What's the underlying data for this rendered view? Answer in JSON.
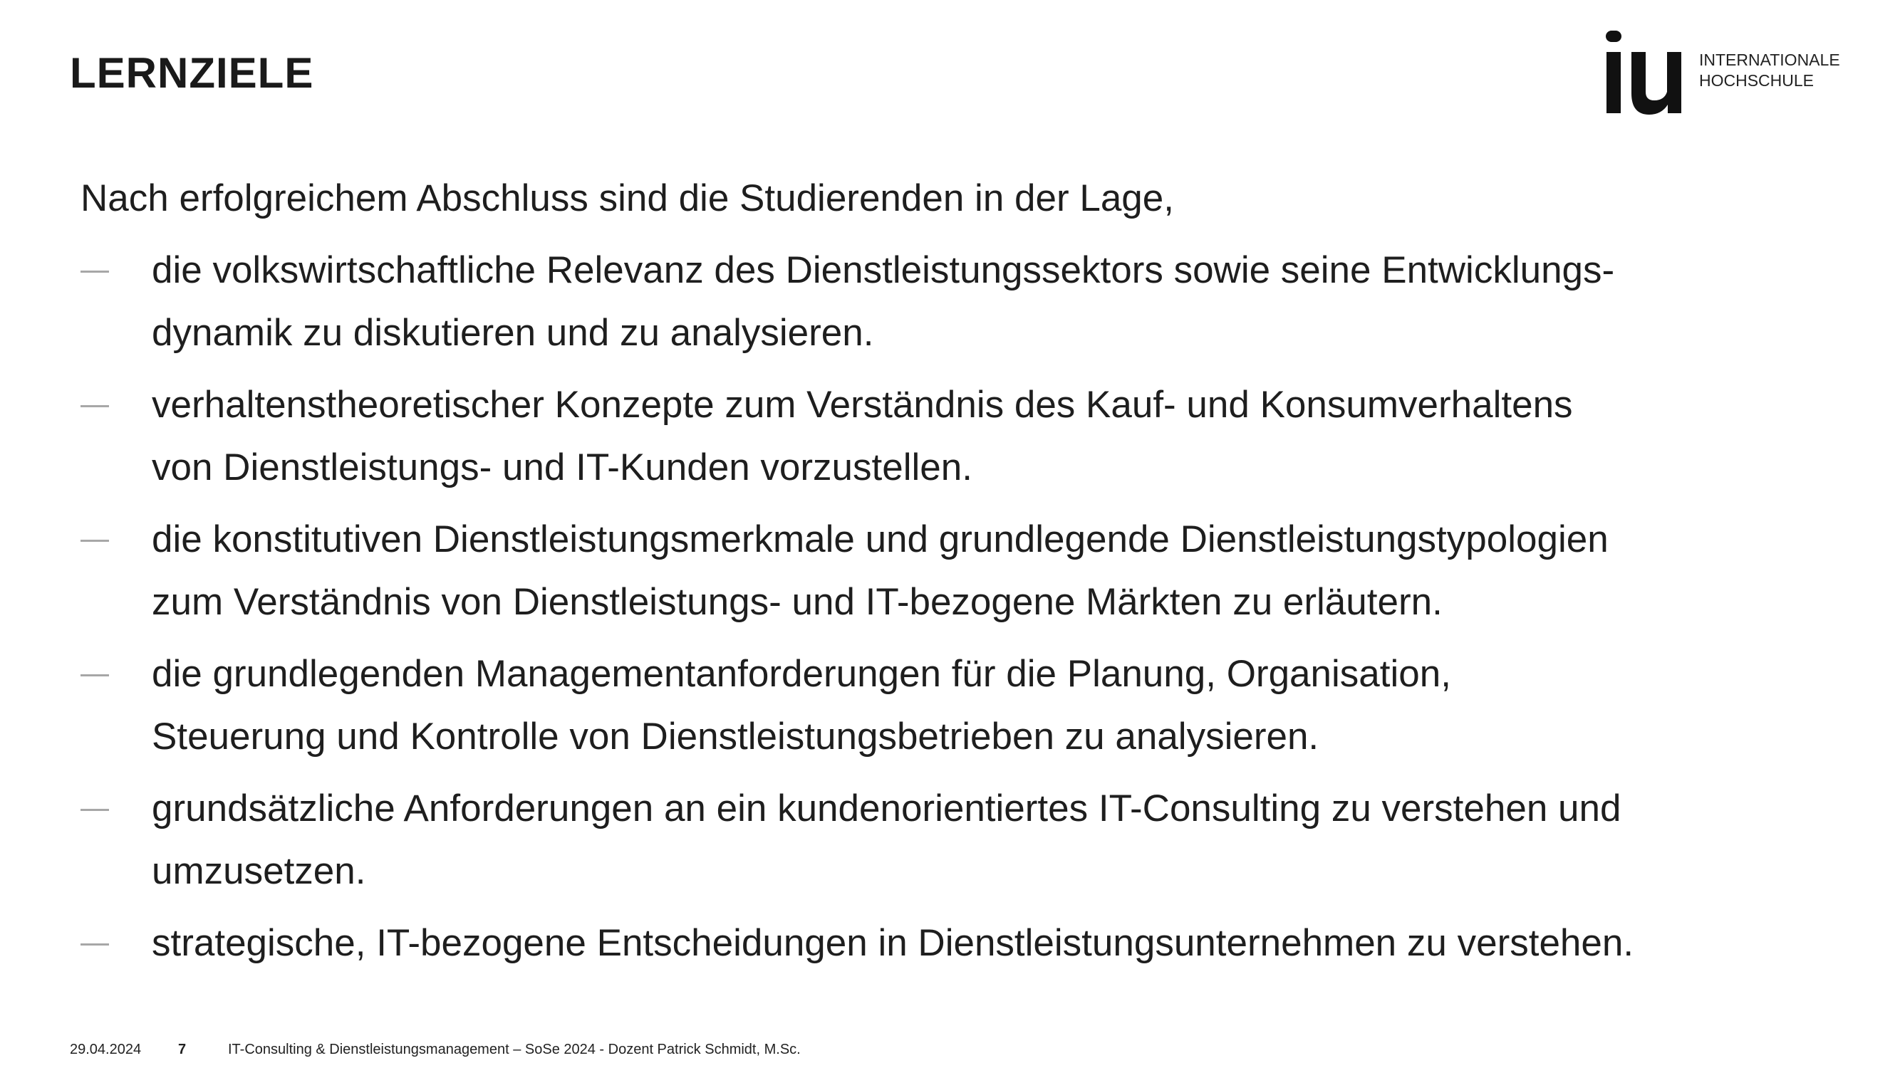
{
  "slide": {
    "title": "LERNZIELE",
    "logo": {
      "mark": "iu",
      "line1": "INTERNATIONALE",
      "line2": "HOCHSCHULE"
    },
    "intro": "Nach erfolgreichem Abschluss sind die Studierenden in der Lage,",
    "bullets": [
      {
        "line1": "die volkswirtschaftliche Relevanz des Dienstleistungssektors sowie seine Entwicklungs-",
        "line2": "dynamik zu diskutieren und zu analysieren."
      },
      {
        "line1": "verhaltenstheoretischer Konzepte zum Verständnis des Kauf- und Konsumverhaltens",
        "line2": "von Dienstleistungs- und IT-Kunden vorzustellen."
      },
      {
        "line1": "die konstitutiven Dienstleistungsmerkmale und grundlegende Dienstleistungstypologien",
        "line2": "zum Verständnis von Dienstleistungs- und IT-bezogene Märkten zu erläutern."
      },
      {
        "line1": "die grundlegenden Managementanforderungen für die Planung, Organisation,",
        "line2": "Steuerung und Kontrolle von Dienstleistungsbetrieben zu analysieren."
      },
      {
        "line1": "grundsätzliche Anforderungen an ein kundenorientiertes IT-Consulting zu verstehen und",
        "line2": "umzusetzen."
      },
      {
        "line1": "strategische, IT-bezogene Entscheidungen in Dienstleistungsunternehmen zu verstehen."
      }
    ],
    "footer": {
      "date": "29.04.2024",
      "page": "7",
      "course": "IT-Consulting & Dienstleistungsmanagement – SoSe 2024 - Dozent Patrick Schmidt, M.Sc."
    }
  },
  "colors": {
    "text": "#1e1e1e",
    "dash": "#a7a7a7",
    "background": "#ffffff"
  }
}
